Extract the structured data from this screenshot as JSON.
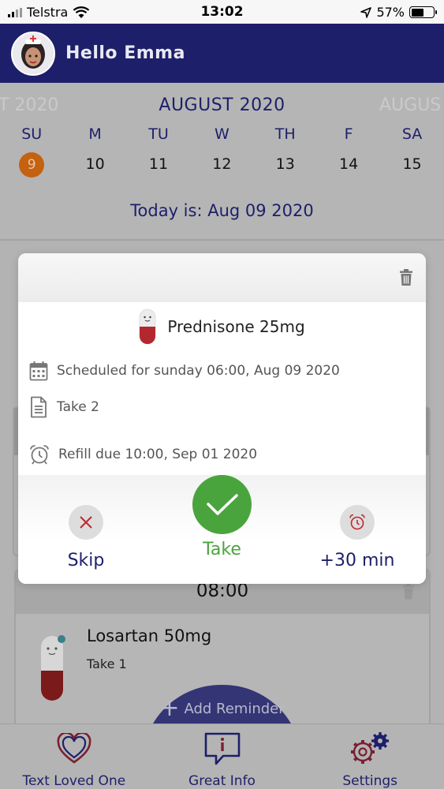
{
  "status_bar": {
    "carrier": "Telstra",
    "time": "13:02",
    "battery_percent": "57%",
    "battery_level": 0.57
  },
  "header": {
    "greeting": "Hello Emma"
  },
  "calendar": {
    "prev_month": "T 2020",
    "current_month": "AUGUST 2020",
    "next_month": "AUGUS",
    "days": [
      {
        "label": "SU",
        "date": "9",
        "selected": true
      },
      {
        "label": "M",
        "date": "10"
      },
      {
        "label": "TU",
        "date": "11"
      },
      {
        "label": "W",
        "date": "12"
      },
      {
        "label": "TH",
        "date": "13"
      },
      {
        "label": "F",
        "date": "14"
      },
      {
        "label": "SA",
        "date": "15"
      }
    ],
    "today_text": "Today is: Aug 09 2020",
    "selected_color": "#c4620f"
  },
  "modal": {
    "medication": "Prednisone 25mg",
    "scheduled": "Scheduled for sunday 06:00, Aug 09 2020",
    "dose": "Take 2",
    "refill": "Refill due 10:00, Sep 01 2020",
    "actions": {
      "skip": "Skip",
      "take": "Take",
      "snooze": "+30 min"
    }
  },
  "reminders": [
    {
      "time": "08:00",
      "medication": "Losartan 50mg",
      "dose": "Take 1"
    }
  ],
  "fab": {
    "label": "Add Reminder"
  },
  "bottom_nav": [
    {
      "label": "Text Loved One",
      "icon": "heart-icon"
    },
    {
      "label": "Great Info",
      "icon": "info-chat-icon"
    },
    {
      "label": "Settings",
      "icon": "gear-icon"
    }
  ],
  "colors": {
    "primary": "#1d1f6a",
    "success": "#4aa43d",
    "danger": "#b22222",
    "overlay": "#b3b3b3"
  }
}
